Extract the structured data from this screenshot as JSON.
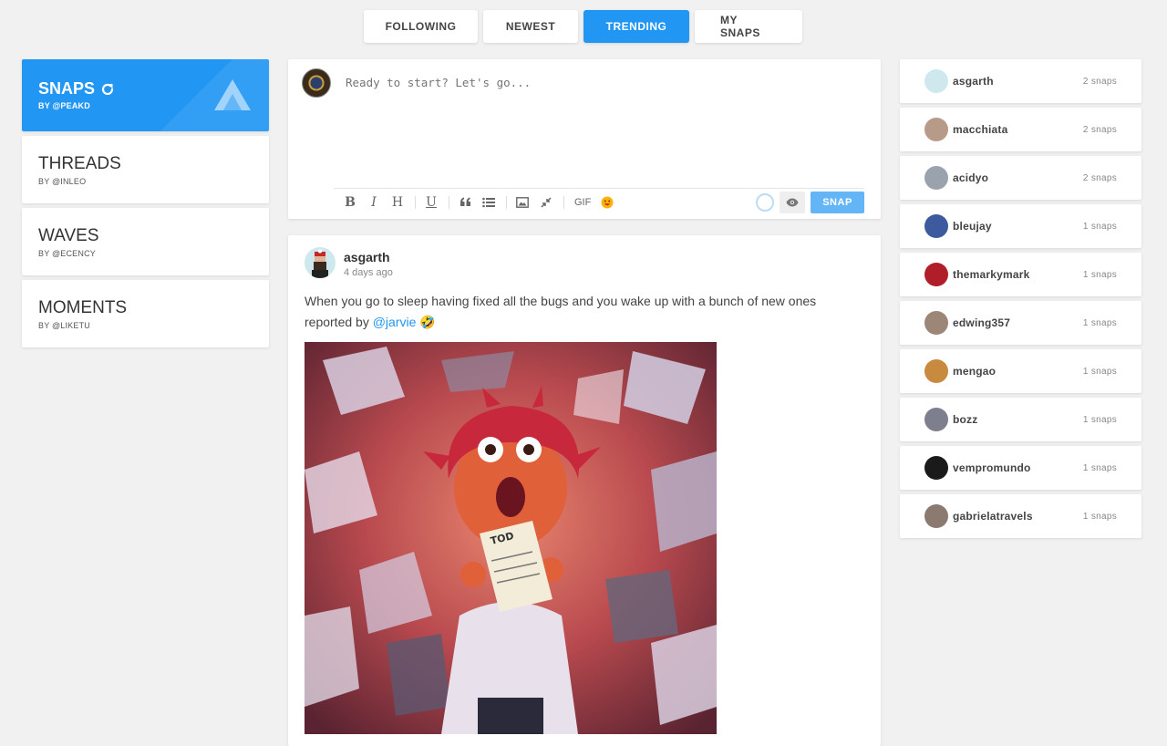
{
  "tabs": [
    {
      "label": "FOLLOWING"
    },
    {
      "label": "NEWEST"
    },
    {
      "label": "TRENDING",
      "active": true
    },
    {
      "label": "MY SNAPS"
    }
  ],
  "sources": [
    {
      "title": "SNAPS",
      "by": "BY @PEAKD",
      "active": true,
      "icon": "refresh-icon"
    },
    {
      "title": "THREADS",
      "by": "BY @INLEO"
    },
    {
      "title": "WAVES",
      "by": "BY @ECENCY"
    },
    {
      "title": "MOMENTS",
      "by": "BY @LIKETU"
    }
  ],
  "composer": {
    "placeholder": "Ready to start? Let's go...",
    "toolbar": [
      "B",
      "I",
      "H",
      "U",
      "quote-icon",
      "list-icon",
      "image-icon",
      "compress-icon",
      "GIF",
      "emoji-icon"
    ],
    "gif_label": "GIF",
    "snap_label": "SNAP"
  },
  "post": {
    "author": "asgarth",
    "time": "4 days ago",
    "text_before": "When you go to sleep having fixed all the bugs and you wake up with a bunch of new ones reported by ",
    "mention": "@jarvie",
    "emoji": "🤣"
  },
  "top_users": [
    {
      "name": "asgarth",
      "count": "2 snaps",
      "color": "#cfe8ee"
    },
    {
      "name": "macchiata",
      "count": "2 snaps",
      "color": "#b89a88"
    },
    {
      "name": "acidyo",
      "count": "2 snaps",
      "color": "#9aa3ad"
    },
    {
      "name": "bleujay",
      "count": "1 snaps",
      "color": "#3d5a9e"
    },
    {
      "name": "themarkymark",
      "count": "1 snaps",
      "color": "#b01e2a"
    },
    {
      "name": "edwing357",
      "count": "1 snaps",
      "color": "#9b8678"
    },
    {
      "name": "mengao",
      "count": "1 snaps",
      "color": "#c78a3e"
    },
    {
      "name": "bozz",
      "count": "1 snaps",
      "color": "#7d7f8e"
    },
    {
      "name": "vempromundo",
      "count": "1 snaps",
      "color": "#1a1a1a"
    },
    {
      "name": "gabrielatravels",
      "count": "1 snaps",
      "color": "#8c7a70"
    }
  ]
}
